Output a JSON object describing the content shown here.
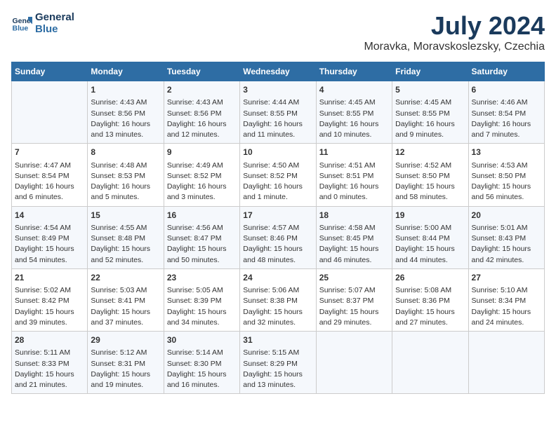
{
  "header": {
    "logo_line1": "General",
    "logo_line2": "Blue",
    "month": "July 2024",
    "location": "Moravka, Moravskoslezsky, Czechia"
  },
  "days_of_week": [
    "Sunday",
    "Monday",
    "Tuesday",
    "Wednesday",
    "Thursday",
    "Friday",
    "Saturday"
  ],
  "weeks": [
    [
      {
        "day": "",
        "content": ""
      },
      {
        "day": "1",
        "content": "Sunrise: 4:43 AM\nSunset: 8:56 PM\nDaylight: 16 hours\nand 13 minutes."
      },
      {
        "day": "2",
        "content": "Sunrise: 4:43 AM\nSunset: 8:56 PM\nDaylight: 16 hours\nand 12 minutes."
      },
      {
        "day": "3",
        "content": "Sunrise: 4:44 AM\nSunset: 8:55 PM\nDaylight: 16 hours\nand 11 minutes."
      },
      {
        "day": "4",
        "content": "Sunrise: 4:45 AM\nSunset: 8:55 PM\nDaylight: 16 hours\nand 10 minutes."
      },
      {
        "day": "5",
        "content": "Sunrise: 4:45 AM\nSunset: 8:55 PM\nDaylight: 16 hours\nand 9 minutes."
      },
      {
        "day": "6",
        "content": "Sunrise: 4:46 AM\nSunset: 8:54 PM\nDaylight: 16 hours\nand 7 minutes."
      }
    ],
    [
      {
        "day": "7",
        "content": "Sunrise: 4:47 AM\nSunset: 8:54 PM\nDaylight: 16 hours\nand 6 minutes."
      },
      {
        "day": "8",
        "content": "Sunrise: 4:48 AM\nSunset: 8:53 PM\nDaylight: 16 hours\nand 5 minutes."
      },
      {
        "day": "9",
        "content": "Sunrise: 4:49 AM\nSunset: 8:52 PM\nDaylight: 16 hours\nand 3 minutes."
      },
      {
        "day": "10",
        "content": "Sunrise: 4:50 AM\nSunset: 8:52 PM\nDaylight: 16 hours\nand 1 minute."
      },
      {
        "day": "11",
        "content": "Sunrise: 4:51 AM\nSunset: 8:51 PM\nDaylight: 16 hours\nand 0 minutes."
      },
      {
        "day": "12",
        "content": "Sunrise: 4:52 AM\nSunset: 8:50 PM\nDaylight: 15 hours\nand 58 minutes."
      },
      {
        "day": "13",
        "content": "Sunrise: 4:53 AM\nSunset: 8:50 PM\nDaylight: 15 hours\nand 56 minutes."
      }
    ],
    [
      {
        "day": "14",
        "content": "Sunrise: 4:54 AM\nSunset: 8:49 PM\nDaylight: 15 hours\nand 54 minutes."
      },
      {
        "day": "15",
        "content": "Sunrise: 4:55 AM\nSunset: 8:48 PM\nDaylight: 15 hours\nand 52 minutes."
      },
      {
        "day": "16",
        "content": "Sunrise: 4:56 AM\nSunset: 8:47 PM\nDaylight: 15 hours\nand 50 minutes."
      },
      {
        "day": "17",
        "content": "Sunrise: 4:57 AM\nSunset: 8:46 PM\nDaylight: 15 hours\nand 48 minutes."
      },
      {
        "day": "18",
        "content": "Sunrise: 4:58 AM\nSunset: 8:45 PM\nDaylight: 15 hours\nand 46 minutes."
      },
      {
        "day": "19",
        "content": "Sunrise: 5:00 AM\nSunset: 8:44 PM\nDaylight: 15 hours\nand 44 minutes."
      },
      {
        "day": "20",
        "content": "Sunrise: 5:01 AM\nSunset: 8:43 PM\nDaylight: 15 hours\nand 42 minutes."
      }
    ],
    [
      {
        "day": "21",
        "content": "Sunrise: 5:02 AM\nSunset: 8:42 PM\nDaylight: 15 hours\nand 39 minutes."
      },
      {
        "day": "22",
        "content": "Sunrise: 5:03 AM\nSunset: 8:41 PM\nDaylight: 15 hours\nand 37 minutes."
      },
      {
        "day": "23",
        "content": "Sunrise: 5:05 AM\nSunset: 8:39 PM\nDaylight: 15 hours\nand 34 minutes."
      },
      {
        "day": "24",
        "content": "Sunrise: 5:06 AM\nSunset: 8:38 PM\nDaylight: 15 hours\nand 32 minutes."
      },
      {
        "day": "25",
        "content": "Sunrise: 5:07 AM\nSunset: 8:37 PM\nDaylight: 15 hours\nand 29 minutes."
      },
      {
        "day": "26",
        "content": "Sunrise: 5:08 AM\nSunset: 8:36 PM\nDaylight: 15 hours\nand 27 minutes."
      },
      {
        "day": "27",
        "content": "Sunrise: 5:10 AM\nSunset: 8:34 PM\nDaylight: 15 hours\nand 24 minutes."
      }
    ],
    [
      {
        "day": "28",
        "content": "Sunrise: 5:11 AM\nSunset: 8:33 PM\nDaylight: 15 hours\nand 21 minutes."
      },
      {
        "day": "29",
        "content": "Sunrise: 5:12 AM\nSunset: 8:31 PM\nDaylight: 15 hours\nand 19 minutes."
      },
      {
        "day": "30",
        "content": "Sunrise: 5:14 AM\nSunset: 8:30 PM\nDaylight: 15 hours\nand 16 minutes."
      },
      {
        "day": "31",
        "content": "Sunrise: 5:15 AM\nSunset: 8:29 PM\nDaylight: 15 hours\nand 13 minutes."
      },
      {
        "day": "",
        "content": ""
      },
      {
        "day": "",
        "content": ""
      },
      {
        "day": "",
        "content": ""
      }
    ]
  ]
}
